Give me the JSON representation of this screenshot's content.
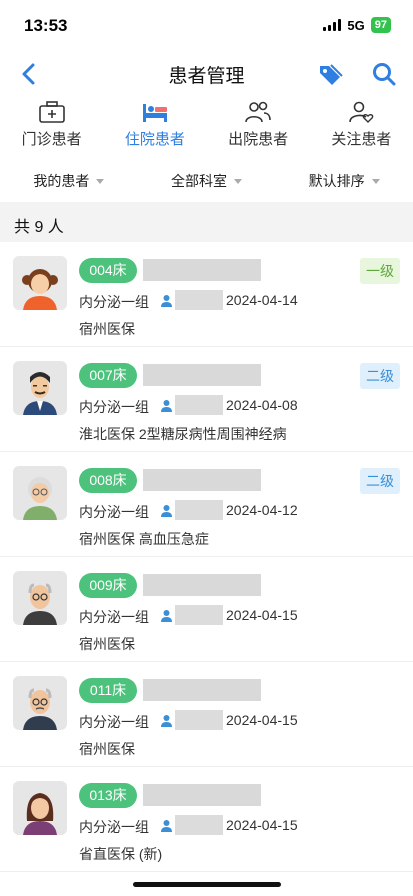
{
  "status_bar": {
    "time": "13:53",
    "network": "5G",
    "battery": "97"
  },
  "nav": {
    "title": "患者管理"
  },
  "tabs": [
    {
      "label": "门诊患者",
      "icon": "medical-kit-icon",
      "active": false
    },
    {
      "label": "住院患者",
      "icon": "hospital-bed-icon",
      "active": true
    },
    {
      "label": "出院患者",
      "icon": "people-icon",
      "active": false
    },
    {
      "label": "关注患者",
      "icon": "user-heart-icon",
      "active": false
    }
  ],
  "filters": [
    {
      "label": "我的患者"
    },
    {
      "label": "全部科室"
    },
    {
      "label": "默认排序"
    }
  ],
  "count_text": "共 9 人",
  "colors": {
    "accent": "#2f7fe0",
    "bed_badge": "#4cc27c",
    "level1_text": "#5fa83a",
    "level2_text": "#3a8fd6"
  },
  "patients": [
    {
      "bed": "004床",
      "level": "一级",
      "dept": "内分泌一组",
      "date": "2024-04-14",
      "insurance": "宿州医保",
      "avatar": "girl-avatar"
    },
    {
      "bed": "007床",
      "level": "二级",
      "dept": "内分泌一组",
      "date": "2024-04-08",
      "insurance": "淮北医保  2型糖尿病性周围神经病",
      "avatar": "man-avatar"
    },
    {
      "bed": "008床",
      "level": "二级",
      "dept": "内分泌一组",
      "date": "2024-04-12",
      "insurance": "宿州医保  高血压急症",
      "avatar": "elderly-woman-avatar"
    },
    {
      "bed": "009床",
      "level": "",
      "dept": "内分泌一组",
      "date": "2024-04-15",
      "insurance": "宿州医保",
      "avatar": "elderly-man-avatar"
    },
    {
      "bed": "011床",
      "level": "",
      "dept": "内分泌一组",
      "date": "2024-04-15",
      "insurance": "宿州医保",
      "avatar": "elderly-man-avatar"
    },
    {
      "bed": "013床",
      "level": "",
      "dept": "内分泌一组",
      "date": "2024-04-15",
      "insurance": "省直医保 (新)",
      "avatar": "woman-avatar"
    }
  ]
}
